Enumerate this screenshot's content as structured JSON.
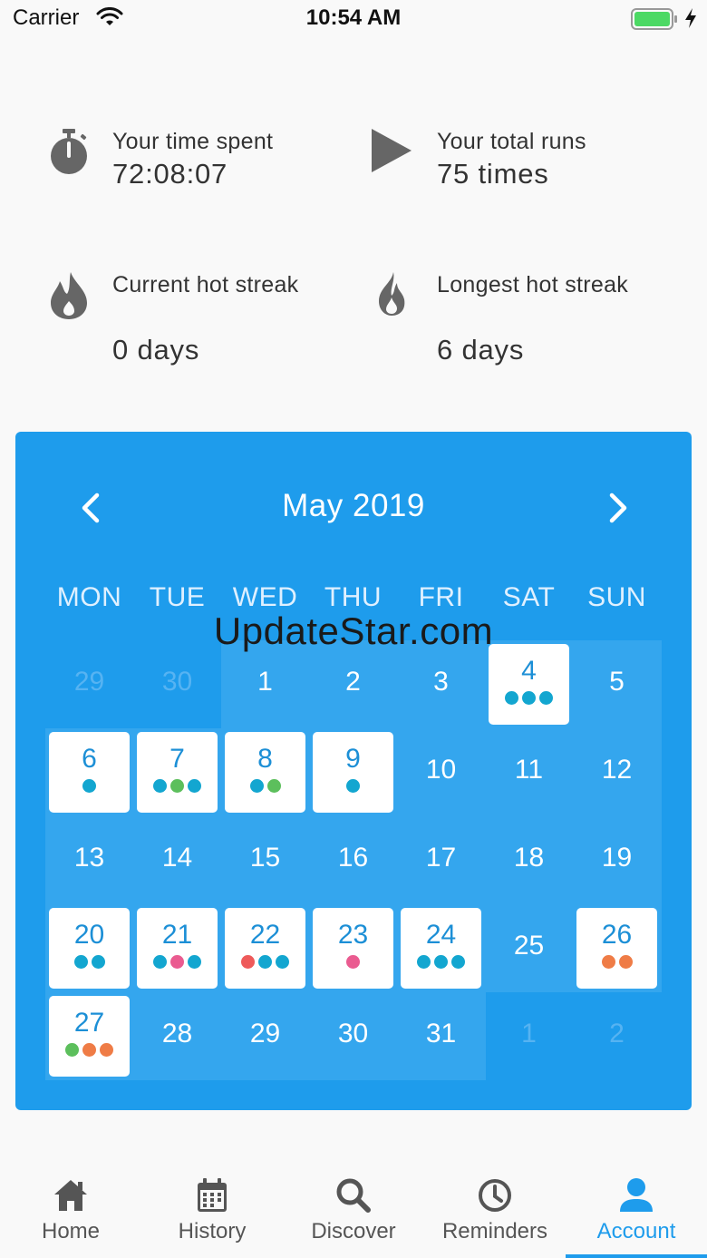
{
  "status_bar": {
    "carrier": "Carrier",
    "time": "10:54 AM"
  },
  "stats": [
    {
      "label": "Your time spent",
      "value": "72:08:07",
      "icon": "stopwatch-icon"
    },
    {
      "label": "Your total runs",
      "value": "75 times",
      "icon": "play-icon"
    },
    {
      "label": "Current hot streak",
      "value": "0 days",
      "icon": "drop-flame-icon"
    },
    {
      "label": "Longest hot streak",
      "value": "6 days",
      "icon": "flame-icon"
    }
  ],
  "calendar": {
    "title": "May 2019",
    "weekdays": [
      "MON",
      "TUE",
      "WED",
      "THU",
      "FRI",
      "SAT",
      "SUN"
    ],
    "colors": {
      "background": "#1e9cec",
      "band": "#34a6ee",
      "card_text": "#1c8fd6"
    },
    "dot_colors": {
      "cyan": "#13a6d0",
      "green": "#5cbf5c",
      "pink": "#ea5b90",
      "red": "#ee5a5a",
      "orange": "#ef7c46"
    },
    "weeks": [
      [
        {
          "n": "29",
          "faded": true
        },
        {
          "n": "30",
          "faded": true
        },
        {
          "n": "1"
        },
        {
          "n": "2"
        },
        {
          "n": "3"
        },
        {
          "n": "4",
          "dots": [
            "cyan",
            "cyan",
            "cyan"
          ]
        },
        {
          "n": "5"
        }
      ],
      [
        {
          "n": "6",
          "dots": [
            "cyan"
          ]
        },
        {
          "n": "7",
          "dots": [
            "cyan",
            "green",
            "cyan"
          ]
        },
        {
          "n": "8",
          "dots": [
            "cyan",
            "green"
          ]
        },
        {
          "n": "9",
          "dots": [
            "cyan"
          ]
        },
        {
          "n": "10"
        },
        {
          "n": "11"
        },
        {
          "n": "12"
        }
      ],
      [
        {
          "n": "13"
        },
        {
          "n": "14"
        },
        {
          "n": "15"
        },
        {
          "n": "16"
        },
        {
          "n": "17"
        },
        {
          "n": "18"
        },
        {
          "n": "19"
        }
      ],
      [
        {
          "n": "20",
          "dots": [
            "cyan",
            "cyan"
          ]
        },
        {
          "n": "21",
          "dots": [
            "cyan",
            "pink",
            "cyan"
          ]
        },
        {
          "n": "22",
          "dots": [
            "red",
            "cyan",
            "cyan"
          ]
        },
        {
          "n": "23",
          "dots": [
            "pink"
          ]
        },
        {
          "n": "24",
          "dots": [
            "cyan",
            "cyan",
            "cyan"
          ]
        },
        {
          "n": "25"
        },
        {
          "n": "26",
          "dots": [
            "orange",
            "orange"
          ]
        }
      ],
      [
        {
          "n": "27",
          "dots": [
            "green",
            "orange",
            "orange"
          ]
        },
        {
          "n": "28"
        },
        {
          "n": "29"
        },
        {
          "n": "30"
        },
        {
          "n": "31"
        },
        {
          "n": "1",
          "faded": true
        },
        {
          "n": "2",
          "faded": true
        }
      ]
    ]
  },
  "tabs": [
    {
      "label": "Home",
      "icon": "home-icon"
    },
    {
      "label": "History",
      "icon": "calendar-icon"
    },
    {
      "label": "Discover",
      "icon": "search-icon"
    },
    {
      "label": "Reminders",
      "icon": "clock-icon"
    },
    {
      "label": "Account",
      "icon": "user-icon",
      "active": true
    }
  ],
  "watermark": "UpdateStar.com"
}
